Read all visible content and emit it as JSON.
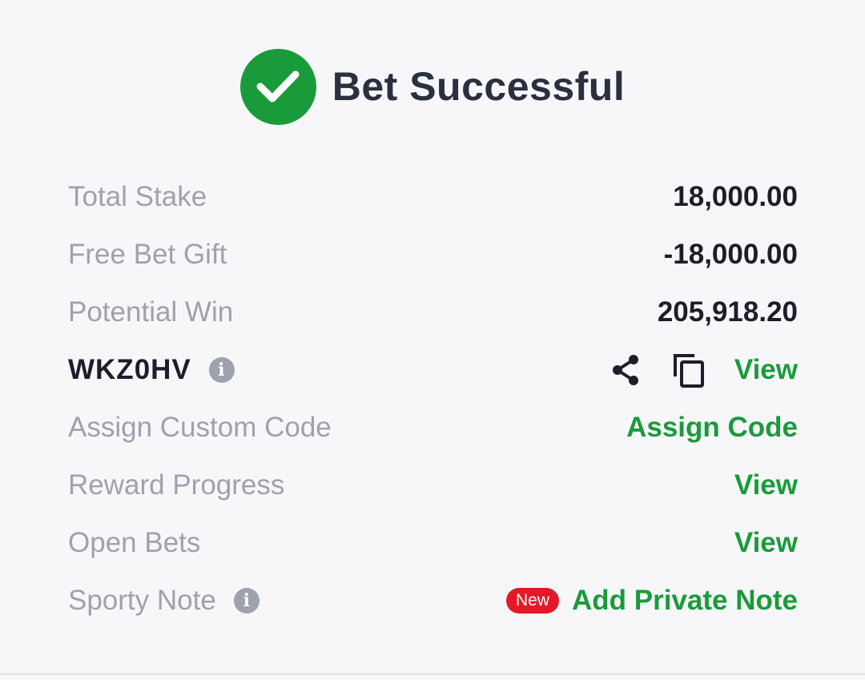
{
  "header": {
    "title": "Bet Successful"
  },
  "rows": {
    "total_stake": {
      "label": "Total Stake",
      "value": "18,000.00"
    },
    "free_bet": {
      "label": "Free Bet Gift",
      "value": "-18,000.00"
    },
    "potential_win": {
      "label": "Potential Win",
      "value": "205,918.20"
    },
    "booking": {
      "code": "WKZ0HV",
      "view": "View"
    },
    "custom_code": {
      "label": "Assign Custom Code",
      "action": "Assign Code"
    },
    "reward": {
      "label": "Reward Progress",
      "action": "View"
    },
    "open_bets": {
      "label": "Open Bets",
      "action": "View"
    },
    "note": {
      "label": "Sporty Note",
      "badge": "New",
      "action": "Add Private Note"
    }
  },
  "colors": {
    "accent": "#1a9b3b",
    "badge": "#e41827",
    "label": "#9ea2ad",
    "text": "#1c1f29"
  },
  "icons": [
    "check-icon",
    "info-icon",
    "share-icon",
    "copy-icon"
  ]
}
